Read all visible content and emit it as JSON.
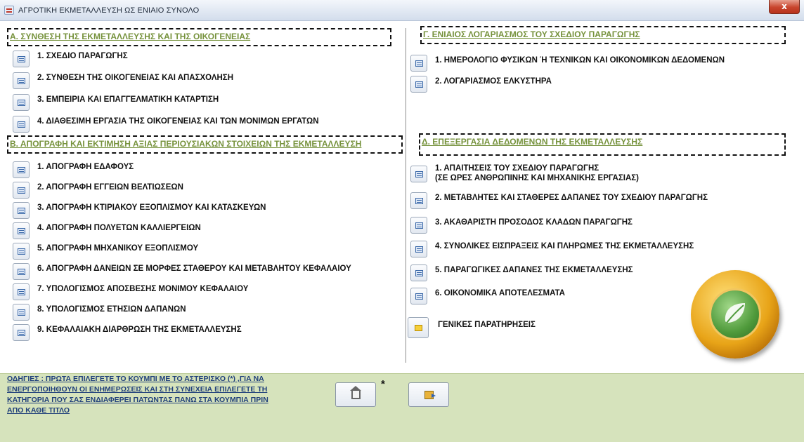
{
  "window": {
    "title": "ΑΓΡΟΤΙΚΗ ΕΚΜΕΤΑΛΛΕΥΣΗ ΩΣ ΕΝΙΑΙΟ ΣΥΝΟΛΟ",
    "close_label": "x"
  },
  "section_a": {
    "header": "Α. ΣΥΝΘΕΣΗ ΤΗΣ ΕΚΜΕΤΑΛΛΕΥΣΗΣ ΚΑΙ ΤΗΣ ΟΙΚΟΓΕΝΕΙΑΣ",
    "items": [
      {
        "label": "1. ΣΧΕΔΙΟ ΠΑΡΑΓΩΓΗΣ"
      },
      {
        "label": "2. ΣΥΝΘΕΣΗ ΤΗΣ ΟΙΚΟΓΕΝΕΙΑΣ ΚΑΙ ΑΠΑΣΧΟΛΗΣΗ"
      },
      {
        "label": "3. ΕΜΠΕΙΡΙΑ ΚΑΙ ΕΠΑΓΓΕΛΜΑΤΙΚΗ ΚΑΤΑΡΤΙΣΗ"
      },
      {
        "label": "4. ΔΙΑΘΕΣΙΜΗ ΕΡΓΑΣΙΑ ΤΗΣ ΟΙΚΟΓΕΝΕΙΑΣ ΚΑΙ ΤΩΝ ΜΟΝΙΜΩΝ ΕΡΓΑΤΩΝ"
      }
    ]
  },
  "section_b": {
    "header": "Β. ΑΠΟΓΡΑΦΗ ΚΑΙ ΕΚΤΙΜΗΣΗ ΑΞΙΑΣ ΠΕΡΙΟΥΣΙΑΚΩΝ ΣΤΟΙΧΕΙΩΝ ΤΗΣ ΕΚΜΕΤΑΛΛΕΥΣΗ",
    "items": [
      {
        "label": "1. ΑΠΟΓΡΑΦΗ ΕΔΑΦΟΥΣ"
      },
      {
        "label": "2. ΑΠΟΓΡΑΦΗ ΕΓΓΕΙΩΝ ΒΕΛΤΙΩΣΕΩΝ"
      },
      {
        "label": "3. ΑΠΟΓΡΑΦΗ ΚΤΙΡΙΑΚΟΥ ΕΞΟΠΛΙΣΜΟΥ ΚΑΙ ΚΑΤΑΣΚΕΥΩΝ"
      },
      {
        "label": "4. ΑΠΟΓΡΑΦΗ ΠΟΛΥΕΤΩΝ ΚΑΛΛΙΕΡΓΕΙΩΝ"
      },
      {
        "label": "5. ΑΠΟΓΡΑΦΗ ΜΗΧΑΝΙΚΟΥ ΕΞΟΠΛΙΣΜΟΥ"
      },
      {
        "label": "6. ΑΠΟΓΡΑΦΗ ΔΑΝΕΙΩΝ ΣΕ ΜΟΡΦΕΣ ΣΤΑΘΕΡΟΥ ΚΑΙ ΜΕΤΑΒΛΗΤΟΥ ΚΕΦΑΛΑΙΟΥ"
      },
      {
        "label": "7. ΥΠΟΛΟΓΙΣΜΟΣ ΑΠΟΣΒΕΣΗΣ ΜΟΝΙΜΟΥ ΚΕΦΑΛΑΙΟΥ"
      },
      {
        "label": "8. ΥΠΟΛΟΓΙΣΜΟΣ ΕΤΗΣΙΩΝ ΔΑΠΑΝΩΝ"
      },
      {
        "label": "9. ΚΕΦΑΛΑΙΑΚΗ ΔΙΑΡΘΡΩΣΗ ΤΗΣ ΕΚΜΕΤΑΛΛΕΥΣΗΣ"
      }
    ]
  },
  "section_c": {
    "header": "Γ. ΕΝΙΑΙΟΣ ΛΟΓΑΡΙΑΣΜΟΣ ΤΟΥ ΣΧΕΔΙΟΥ ΠΑΡΑΓΩΓΗΣ",
    "items": [
      {
        "label": "1. ΗΜΕΡΟΛΟΓΙΟ ΦΥΣΙΚΩΝ Ή ΤΕΧΝΙΚΩΝ ΚΑΙ ΟΙΚΟΝΟΜΙΚΩΝ ΔΕΔΟΜΕΝΩΝ"
      },
      {
        "label": "2. ΛΟΓΑΡΙΑΣΜΟΣ ΕΛΚΥΣΤΗΡΑ"
      }
    ]
  },
  "section_d": {
    "header": "Δ. ΕΠΕΞΕΡΓΑΣΙΑ ΔΕΔΟΜΕΝΩΝ ΤΗΣ ΕΚΜΕΤΑΛΛΕΥΣΗΣ",
    "items": [
      {
        "label": "1. ΑΠΑΙΤΗΣΕΙΣ ΤΟΥ ΣΧΕΔΙΟΥ ΠΑΡΑΓΩΓΗΣ",
        "label2": "(ΣΕ ΩΡΕΣ ΑΝΘΡΩΠΙΝΗΣ ΚΑΙ ΜΗΧΑΝΙΚΗΣ ΕΡΓΑΣΙΑΣ)"
      },
      {
        "label": "2. ΜΕΤΑΒΛΗΤΕΣ ΚΑΙ ΣΤΑΘΕΡΕΣ ΔΑΠΑΝΕΣ ΤΟΥ ΣΧΕΔΙΟΥ ΠΑΡΑΓΩΓΗΣ"
      },
      {
        "label": "3. ΑΚΑΘΑΡΙΣΤΗ ΠΡΟΣΟΔΟΣ ΚΛΑΔΩΝ ΠΑΡΑΓΩΓΗΣ"
      },
      {
        "label": "4. ΣΥΝΟΛΙΚΕΣ ΕΙΣΠΡΑΞΕΙΣ ΚΑΙ ΠΛΗΡΩΜΕΣ ΤΗΣ ΕΚΜΕΤΑΛΛΕΥΣΗΣ"
      },
      {
        "label": "5. ΠΑΡΑΓΩΓΙΚΕΣ ΔΑΠΑΝΕΣ ΤΗΣ ΕΚΜΕΤΑΛΛΕΥΣΗΣ"
      },
      {
        "label": "6. ΟΙΚΟΝΟΜΙΚΑ ΑΠΟΤΕΛΕΣΜΑΤΑ"
      }
    ],
    "notes_label": "ΓΕΝΙΚΕΣ ΠΑΡΑΤΗΡΗΣΕΙΣ"
  },
  "footer": {
    "instructions_line1": "ΟΔΗΓΙΕΣ : ΠΡΩΤΑ ΕΠΙΛΕΓΕΤΕ ΤΟ ΚΟΥΜΠΙ ΜΕ ΤΟ ΑΣΤΕΡΙΣΚΟ (*) ,ΓΙΑ ΝΑ",
    "instructions_line2": "ΕΝΕΡΓΟΠΟΙΗΘΟΥΝ ΟΙ ΕΝΗΜΕΡΩΣΕΙΣ ΚΑΙ ΣΤΗ ΣΥΝΕΧΕΙΑ ΕΠΙΛΕΓΕΤΕ ΤΗ",
    "instructions_line3": "ΚΑΤΗΓΟΡΙΑ ΠΟΥ ΣΑΣ ΕΝΔΙΑΦΕΡΕΙ ΠΑΤΩΝΤΑΣ ΠΑΝΩ ΣΤΑ ΚΟΥΜΠΙΑ ΠΡΙΝ",
    "instructions_line4": "ΑΠΟ ΚΑΘΕ ΤΙΤΛΟ",
    "asterisk": "*",
    "home_icon": "home-icon",
    "exit_icon": "exit-icon"
  },
  "colors": {
    "header_text": "#76923c",
    "footer_bg": "#d6e3bc",
    "instructions_text": "#1f3f7a"
  }
}
